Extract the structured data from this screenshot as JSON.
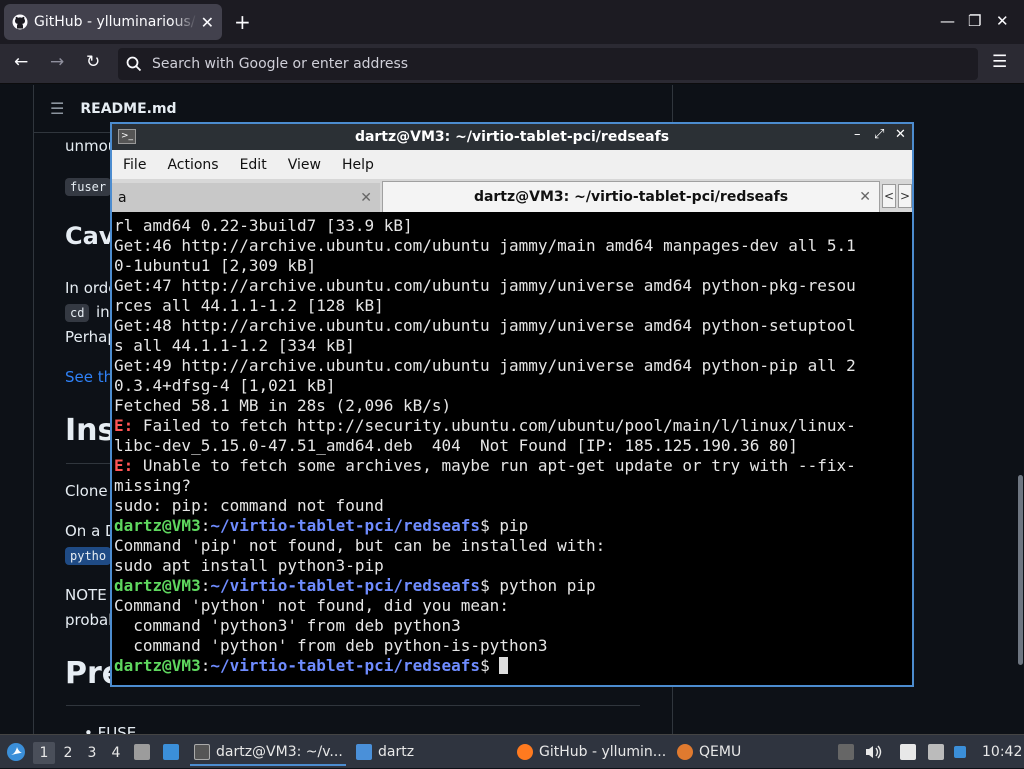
{
  "browser": {
    "tab_title": "GitHub - ylluminarious/re",
    "address_placeholder": "Search with Google or enter address",
    "new_tab": "+",
    "close": "✕",
    "min": "—",
    "max": "❐",
    "back": "←",
    "forward": "→",
    "reload": "↻",
    "menu": "☰"
  },
  "readme": {
    "menu": "☰",
    "file_name": "README.md",
    "line1": "unmou",
    "code1": "fuser",
    "h2_cav": "Cav",
    "p1": "In orde",
    "code_cd": "cd",
    "p1b": "in",
    "p2": "Perhap",
    "link": "See th",
    "h1_ins": "Ins",
    "p3": "Clone",
    "p4": "On a D",
    "code_py": "pytho",
    "p5": "NOTE",
    "p6": "probab",
    "h1_pre": "Pre",
    "li": "• FUSE"
  },
  "terminal": {
    "title": "dartz@VM3: ~/virtio-tablet-pci/redseafs",
    "menu": [
      "File",
      "Actions",
      "Edit",
      "View",
      "Help"
    ],
    "tab1": "a",
    "tab2": "dartz@VM3: ~/virtio-tablet-pci/redseafs",
    "tab_close": "✕",
    "arrow_left": "<",
    "arrow_right": ">",
    "win_min": "–",
    "win_max": "⤢",
    "win_close": "✕",
    "icon": ">_",
    "lines": {
      "l1": "rl amd64 0.22-3build7 [33.9 kB]",
      "l2": "Get:46 http://archive.ubuntu.com/ubuntu jammy/main amd64 manpages-dev all 5.1",
      "l3": "0-1ubuntu1 [2,309 kB]",
      "l4": "Get:47 http://archive.ubuntu.com/ubuntu jammy/universe amd64 python-pkg-resou",
      "l5": "rces all 44.1.1-1.2 [128 kB]",
      "l6": "Get:48 http://archive.ubuntu.com/ubuntu jammy/universe amd64 python-setuptool",
      "l7": "s all 44.1.1-1.2 [334 kB]",
      "l8": "Get:49 http://archive.ubuntu.com/ubuntu jammy/universe amd64 python-pip all 2",
      "l9": "0.3.4+dfsg-4 [1,021 kB]",
      "l10": "Fetched 58.1 MB in 28s (2,096 kB/s)",
      "e_tag": "E:",
      "l11": " Failed to fetch http://security.ubuntu.com/ubuntu/pool/main/l/linux/linux-",
      "l12": "libc-dev_5.15.0-47.51_amd64.deb  404  Not Found [IP: 185.125.190.36 80]",
      "l13": " Unable to fetch some archives, maybe run apt-get update or try with --fix-",
      "l14": "missing?",
      "l15": "sudo: pip: command not found",
      "prompt_user": "dartz@VM3",
      "prompt_colon": ":",
      "prompt_path": "~/virtio-tablet-pci/redseafs",
      "prompt_dollar": "$ ",
      "cmd1": "pip",
      "l16": "Command 'pip' not found, but can be installed with:",
      "l17": "sudo apt install python3-pip",
      "cmd2": "python pip",
      "l18": "Command 'python' not found, did you mean:",
      "l19": "  command 'python3' from deb python3",
      "l20": "  command 'python' from deb python-is-python3"
    }
  },
  "taskbar": {
    "workspaces": [
      "1",
      "2",
      "3",
      "4"
    ],
    "task_terminal": "dartz@VM3: ~/v...",
    "task_files": "dartz",
    "task_firefox": "GitHub - yllumin...",
    "task_qemu": "QEMU",
    "clock": "10:42"
  }
}
